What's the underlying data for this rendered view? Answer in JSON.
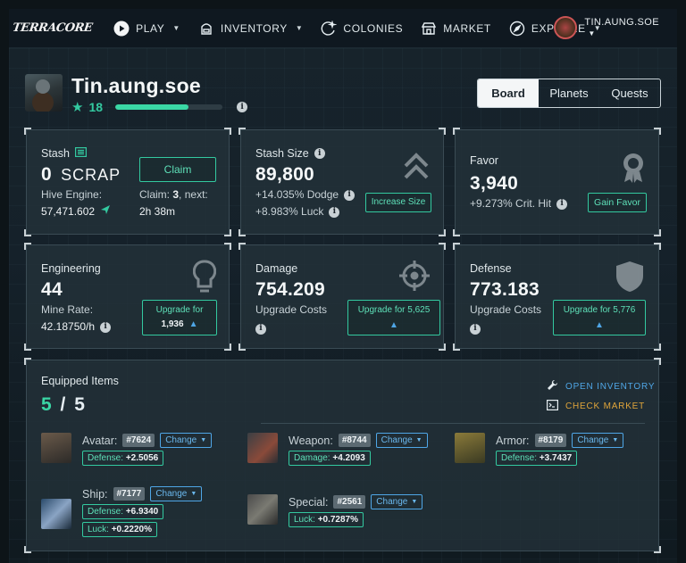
{
  "nav": {
    "logo": "TERRACORE",
    "items": [
      {
        "label": "PLAY",
        "icon": "play-icon",
        "caret": true
      },
      {
        "label": "INVENTORY",
        "icon": "inventory-icon",
        "caret": true
      },
      {
        "label": "COLONIES",
        "icon": "colonies-icon",
        "caret": false
      },
      {
        "label": "MARKET",
        "icon": "market-icon",
        "caret": false
      },
      {
        "label": "EXPLORE",
        "icon": "compass-icon",
        "caret": true
      }
    ],
    "user": "TIN.AUNG.SOE"
  },
  "profile": {
    "name": "Tin.aung.soe",
    "level": "18",
    "xp_fraction": 0.68
  },
  "tabs": [
    "Board",
    "Planets",
    "Quests"
  ],
  "cards": {
    "stash": {
      "title": "Stash",
      "amount": "0",
      "unit": "SCRAP",
      "hive_label": "Hive Engine:",
      "hive_value": "57,471.602",
      "claim_label": "Claim:",
      "claim_count": "3",
      "claim_next": ", next:",
      "claim_time": "2h 38m",
      "button": "Claim"
    },
    "stash_size": {
      "title": "Stash Size",
      "value": "89,800",
      "bonus1": "+14.035% Dodge",
      "bonus2": "+8.983% Luck",
      "button": "Increase Size"
    },
    "favor": {
      "title": "Favor",
      "value": "3,940",
      "bonus": "+9.273% Crit. Hit",
      "button": "Gain Favor"
    },
    "engineering": {
      "title": "Engineering",
      "value": "44",
      "rate_label": "Mine Rate:",
      "rate_value": "42.18750/h",
      "button_line1": "Upgrade for",
      "button_line2": "1,936"
    },
    "damage": {
      "title": "Damage",
      "value": "754.209",
      "sub": "Upgrade Costs",
      "button_line1": "Upgrade for 5,625"
    },
    "defense": {
      "title": "Defense",
      "value": "773.183",
      "sub": "Upgrade Costs",
      "button_line1": "Upgrade for 5,776"
    }
  },
  "equipped": {
    "title": "Equipped Items",
    "count": "5",
    "sep": "/",
    "total": "5",
    "open_inventory": "OPEN INVENTORY",
    "check_market": "CHECK MARKET",
    "change_label": "Change",
    "items": [
      {
        "slot": "Avatar:",
        "id": "#7624",
        "stats": [
          "Defense:",
          "+2.5056"
        ]
      },
      {
        "slot": "Weapon:",
        "id": "#8744",
        "stats": [
          "Damage:",
          "+4.2093"
        ]
      },
      {
        "slot": "Armor:",
        "id": "#8179",
        "stats": [
          "Defense:",
          "+3.7437"
        ]
      },
      {
        "slot": "Ship:",
        "id": "#7177",
        "stats": [
          "Defense:",
          "+6.9340"
        ],
        "stats2": [
          "Luck:",
          "+0.2220%"
        ]
      },
      {
        "slot": "Special:",
        "id": "#2561",
        "stats": [
          "Luck:",
          "+0.7287%"
        ]
      }
    ]
  }
}
